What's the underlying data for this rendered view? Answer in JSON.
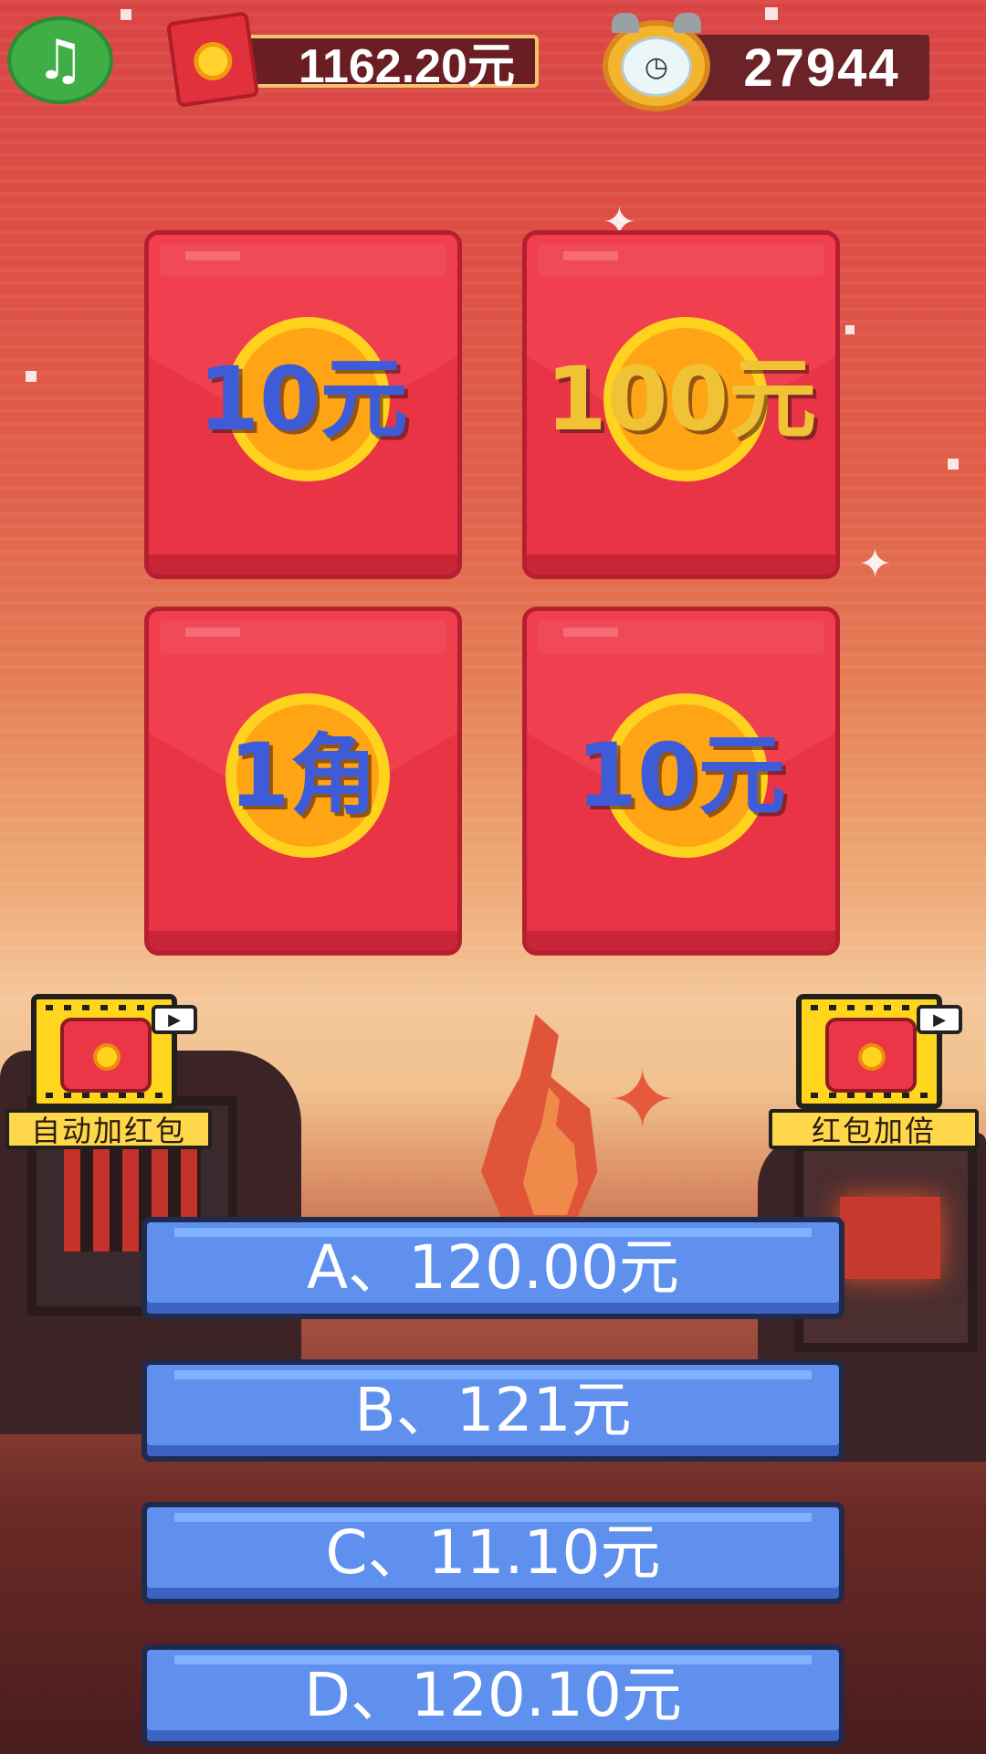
{
  "hud": {
    "music_icon": "music-note-icon",
    "money_icon": "red-envelope-icon",
    "money_balance": "1162.20元",
    "clock_icon": "alarm-clock-icon",
    "time_value": "27944"
  },
  "envelopes": [
    {
      "amount": "10元",
      "color": "#3e5bd8"
    },
    {
      "amount": "100元",
      "color": "#f0c235"
    },
    {
      "amount": "1角",
      "color": "#3e5bd8"
    },
    {
      "amount": "10元",
      "color": "#3e5bd8"
    }
  ],
  "bonus": {
    "auto_add": {
      "label": "自动加红包",
      "icon": "hand-red-envelope-icon"
    },
    "double": {
      "label": "红包加倍",
      "icon": "red-envelopes-icon"
    },
    "video_icon": "video-ad-icon"
  },
  "answers": [
    {
      "label": "A、120.00元"
    },
    {
      "label": "B、121元"
    },
    {
      "label": "C、11.10元"
    },
    {
      "label": "D、120.10元"
    }
  ]
}
